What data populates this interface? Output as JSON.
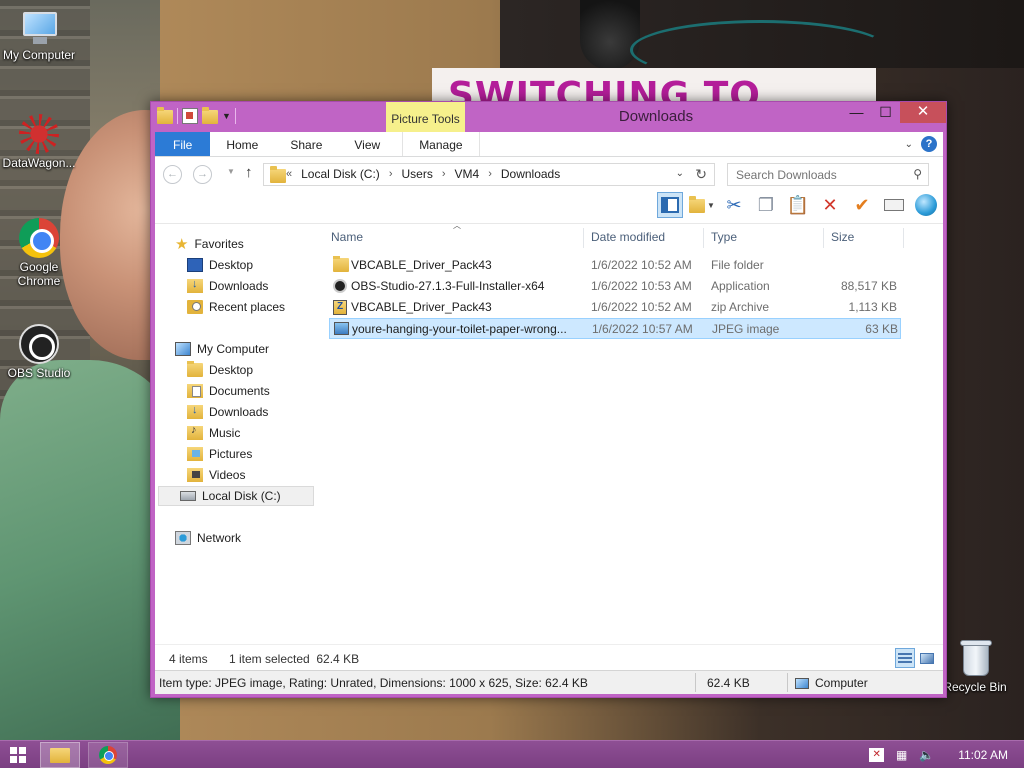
{
  "desktop": {
    "banner_text": "SWITCHING TO",
    "icons": [
      {
        "label": "My Computer"
      },
      {
        "label": "DataWagon..."
      },
      {
        "label": "Google Chrome"
      },
      {
        "label": "OBS Studio"
      },
      {
        "label": "Recycle Bin"
      }
    ]
  },
  "window": {
    "title": "Downloads",
    "context_tab_group": "Picture Tools",
    "controls": {
      "minimize": "—",
      "maximize": "☐",
      "close": "✕"
    },
    "ribbon_tabs": [
      "File",
      "Home",
      "Share",
      "View",
      "Manage"
    ],
    "address": {
      "prefix": "«",
      "crumbs": [
        "Local Disk (C:)",
        "Users",
        "VM4",
        "Downloads"
      ]
    },
    "search": {
      "placeholder": "Search Downloads"
    },
    "nav": {
      "favorites_label": "Favorites",
      "favorites": [
        "Desktop",
        "Downloads",
        "Recent places"
      ],
      "computer_label": "My Computer",
      "computer_items": [
        "Desktop",
        "Documents",
        "Downloads",
        "Music",
        "Pictures",
        "Videos",
        "Local Disk (C:)"
      ],
      "network_label": "Network"
    },
    "columns": {
      "name": "Name",
      "date": "Date modified",
      "type": "Type",
      "size": "Size"
    },
    "files": [
      {
        "name": "VBCABLE_Driver_Pack43",
        "date": "1/6/2022 10:52 AM",
        "type": "File folder",
        "size": ""
      },
      {
        "name": "OBS-Studio-27.1.3-Full-Installer-x64",
        "date": "1/6/2022 10:53 AM",
        "type": "Application",
        "size": "88,517 KB"
      },
      {
        "name": "VBCABLE_Driver_Pack43",
        "date": "1/6/2022 10:52 AM",
        "type": "zip Archive",
        "size": "1,113 KB"
      },
      {
        "name": "youre-hanging-your-toilet-paper-wrong...",
        "date": "1/6/2022 10:57 AM",
        "type": "JPEG image",
        "size": "63 KB"
      }
    ],
    "status": {
      "item_count": "4 items",
      "selection": "1 item selected  62.4 KB"
    },
    "details": {
      "info": "Item type: JPEG image, Rating: Unrated, Dimensions: 1000 x 625, Size: 62.4 KB",
      "size": "62.4 KB",
      "location": "Computer"
    }
  },
  "taskbar": {
    "clock": "11:02 AM",
    "tray": [
      "action-center",
      "network",
      "volume"
    ]
  },
  "colors": {
    "window_frame": "#c064c5",
    "taskbar": "#7b3f82",
    "file_tab": "#2c7bd6",
    "selection": "#cde8ff",
    "picture_tools": "#f6f08c"
  }
}
